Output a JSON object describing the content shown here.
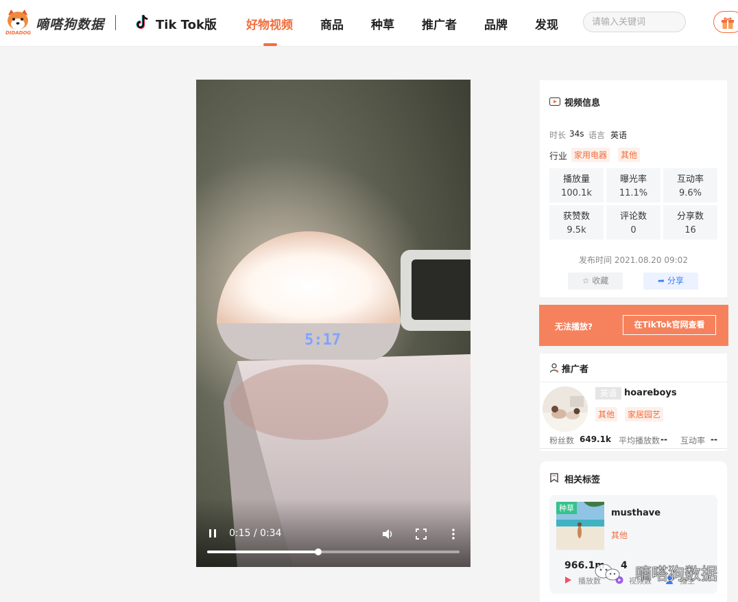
{
  "header": {
    "brand": "嘀嗒狗数据",
    "brand_sub": "DIDADOG",
    "platform": "Tik Tok版",
    "nav": [
      {
        "label": "好物视频"
      },
      {
        "label": "商品"
      },
      {
        "label": "种草"
      },
      {
        "label": "推广者"
      },
      {
        "label": "品牌"
      },
      {
        "label": "发现"
      }
    ],
    "active_nav": "好物视频",
    "search_placeholder": "请输入关键词",
    "colors": {
      "accent": "#f26d3d"
    }
  },
  "video": {
    "current_time": "0:15",
    "duration": "0:34",
    "time_display": "0:15 / 0:34",
    "progress": 0.44,
    "is_playing": true,
    "clock_reading": "5:17"
  },
  "video_info": {
    "title": "视频信息",
    "duration_label": "时长",
    "duration_value": "34s",
    "language_label": "语言",
    "language_value": "英语",
    "industry_label": "行业",
    "industry_tags": [
      "家用电器",
      "其他"
    ],
    "stats": [
      {
        "label": "播放量",
        "value": "100.1k"
      },
      {
        "label": "曝光率",
        "value": "11.1%"
      },
      {
        "label": "互动率",
        "value": "9.6%"
      },
      {
        "label": "获赞数",
        "value": "9.5k"
      },
      {
        "label": "评论数",
        "value": "0"
      },
      {
        "label": "分享数",
        "value": "16"
      }
    ],
    "publish_time": "发布时间 2021.08.20 09:02",
    "favorite_label": "收藏",
    "share_label": "分享"
  },
  "play_banner": {
    "text": "无法播放?",
    "button_label": "在TikTok官网查看"
  },
  "promoter": {
    "title": "推广者",
    "language_badge": "英语",
    "name": "hoareboys",
    "tags": [
      "其他",
      "家居园艺"
    ],
    "fans_label": "粉丝数",
    "fans_value": "649.1k",
    "avg_play_label": "平均播放数",
    "avg_play_value": "--",
    "interaction_label": "互动率",
    "interaction_value": "--"
  },
  "related_tags": {
    "title": "相关标签",
    "items": [
      {
        "badge": "种草",
        "name": "musthave",
        "category": "其他",
        "play_value": "966.1m",
        "play_label": "播放数",
        "video_value": "4",
        "video_label": "视频数",
        "author_label": "播主"
      }
    ]
  },
  "watermark": {
    "text": "嘀嗒狗数据"
  }
}
